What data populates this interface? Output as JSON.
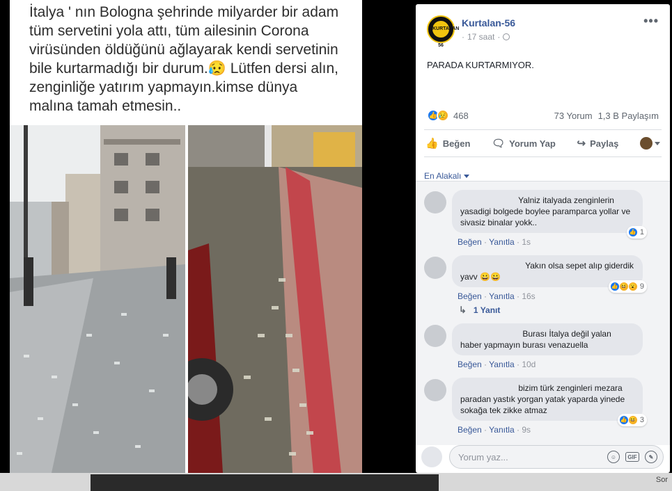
{
  "photo": {
    "caption": "İtalya ' nın Bologna şehrinde milyarder bir adam tüm servetini yola attı, tüm ailesinin Corona virüsünden öldüğünü ağlayarak kendi servetinin bile kurtarmadığı  bir durum.😥 Lütfen dersi alın, zenginliğe yatırım yapmayın.kimse dünya malına tamah etmesin.."
  },
  "post": {
    "author": "Kurtalan-56",
    "avatar_text": "KURTALAN 56",
    "time": "17 saat",
    "text": "PARADA KURTARMIYOR.",
    "reactions_count": "468",
    "comments_count": "73 Yorum",
    "shares_count": "1,3 B Paylaşım",
    "actions": {
      "like": "Beğen",
      "comment": "Yorum Yap",
      "share": "Paylaş"
    },
    "sort_label": "En Alakalı"
  },
  "comments": [
    {
      "text": "Yalniz italyada zenginlerin yasadigi bolgede boylee paramparca yollar ve sivasiz binalar yokk..",
      "like": "Beğen",
      "reply": "Yanıtla",
      "time": "1s",
      "reactions": "1"
    },
    {
      "text": "Yakın olsa sepet alıp giderdik yavv 😀😀",
      "like": "Beğen",
      "reply": "Yanıtla",
      "time": "16s",
      "reactions": "9",
      "replies_label": "1 Yanıt"
    },
    {
      "text": "Burası İtalya değil yalan haber yapmayın burası venazuella",
      "like": "Beğen",
      "reply": "Yanıtla",
      "time": "10d"
    },
    {
      "text": "bizim türk zenginleri mezara paradan yastık yorgan yatak yaparda yinede sokağa tek zikke atmaz",
      "like": "Beğen",
      "reply": "Yanıtla",
      "time": "9s",
      "reactions": "3"
    }
  ],
  "compose": {
    "placeholder": "Yorum yaz...",
    "gif_label": "GIF"
  },
  "strip_text": "Sor"
}
